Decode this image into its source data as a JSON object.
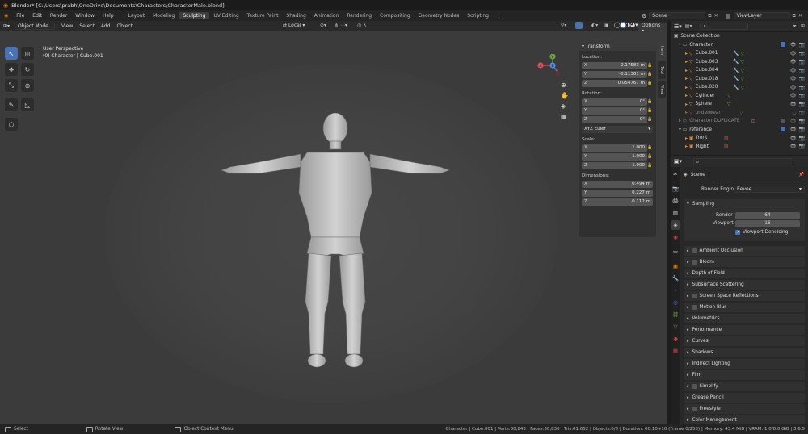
{
  "window": {
    "title": "Blender* [C:\\Users\\prabh\\OneDrive\\Documents\\Characters\\CharacterMale.blend]"
  },
  "menu": {
    "items": [
      "File",
      "Edit",
      "Render",
      "Window",
      "Help"
    ]
  },
  "workspaces": {
    "tabs": [
      "Layout",
      "Modeling",
      "Sculpting",
      "UV Editing",
      "Texture Paint",
      "Shading",
      "Animation",
      "Rendering",
      "Compositing",
      "Geometry Nodes",
      "Scripting"
    ],
    "active": "Sculpting",
    "add": "+"
  },
  "scene": {
    "name": "Scene",
    "view_layer": "ViewLayer"
  },
  "viewport": {
    "mode": "Object Mode",
    "menus": [
      "View",
      "Select",
      "Add",
      "Object"
    ],
    "transform_orientation": "Local",
    "options_label": "Options",
    "perspective": "User Perspective",
    "object_info": "(0) Character | Cube.001",
    "gizmo": {
      "x": "X",
      "y": "Y",
      "z": "Z"
    }
  },
  "npanel": {
    "title": "Transform",
    "location_label": "Location:",
    "location": [
      {
        "axis": "X",
        "value": "0.17583 m"
      },
      {
        "axis": "Y",
        "value": "-0.11361 m"
      },
      {
        "axis": "Z",
        "value": "0.054767 m"
      }
    ],
    "rotation_label": "Rotation:",
    "rotation": [
      {
        "axis": "X",
        "value": "0°"
      },
      {
        "axis": "Y",
        "value": "0°"
      },
      {
        "axis": "Z",
        "value": "0°"
      }
    ],
    "rotation_mode": "XYZ Euler",
    "scale_label": "Scale:",
    "scale": [
      {
        "axis": "X",
        "value": "1.000"
      },
      {
        "axis": "Y",
        "value": "1.000"
      },
      {
        "axis": "Z",
        "value": "1.000"
      }
    ],
    "dimensions_label": "Dimensions:",
    "dimensions": [
      {
        "axis": "X",
        "value": "0.494 m"
      },
      {
        "axis": "Y",
        "value": "0.227 m"
      },
      {
        "axis": "Z",
        "value": "0.112 m"
      }
    ],
    "tabs": [
      "Item",
      "Tool",
      "View"
    ]
  },
  "outliner": {
    "items": [
      {
        "name": "Scene Collection",
        "indent": 0,
        "kind": "scene"
      },
      {
        "name": "Character",
        "indent": 1,
        "kind": "collection"
      },
      {
        "name": "Cube.001",
        "indent": 2,
        "kind": "mesh"
      },
      {
        "name": "Cube.003",
        "indent": 2,
        "kind": "mesh"
      },
      {
        "name": "Cube.004",
        "indent": 2,
        "kind": "mesh"
      },
      {
        "name": "Cube.018",
        "indent": 2,
        "kind": "mesh"
      },
      {
        "name": "Cube.020",
        "indent": 2,
        "kind": "mesh"
      },
      {
        "name": "Cylinder",
        "indent": 2,
        "kind": "mesh"
      },
      {
        "name": "Sphere",
        "indent": 2,
        "kind": "mesh"
      },
      {
        "name": "underwear",
        "indent": 2,
        "kind": "mesh"
      },
      {
        "name": "Character-DUPLICATE",
        "indent": 1,
        "kind": "collection"
      },
      {
        "name": "reference",
        "indent": 1,
        "kind": "collection"
      },
      {
        "name": "front",
        "indent": 2,
        "kind": "image"
      },
      {
        "name": "Right",
        "indent": 2,
        "kind": "image"
      }
    ]
  },
  "properties": {
    "context": "Scene",
    "render_engine_label": "Render Engine",
    "render_engine": "Eevee",
    "sampling": {
      "title": "Sampling",
      "render_label": "Render",
      "render": "64",
      "viewport_label": "Viewport",
      "viewport": "16",
      "denoise": "Viewport Denoising"
    },
    "sections": [
      "Ambient Occlusion",
      "Bloom",
      "Depth of Field",
      "Subsurface Scattering",
      "Screen Space Reflections",
      "Motion Blur",
      "Volumetrics",
      "Performance",
      "Curves",
      "Shadows",
      "Indirect Lighting",
      "Film",
      "Simplify",
      "Grease Pencil",
      "Freestyle",
      "Color Management"
    ],
    "checkbox_sections": [
      "Ambient Occlusion",
      "Bloom",
      "Screen Space Reflections",
      "Motion Blur",
      "Simplify",
      "Freestyle"
    ]
  },
  "statusbar": {
    "left": [
      "Select",
      "Rotate View",
      "Object Context Menu"
    ],
    "right": "Character | Cube.001 | Verts:30,843 | Faces:30,830 | Tris:61,652 | Objects:0/9 | Duration: 00:10+10 (Frame 0/250) | Memory: 43.4 MiB | VRAM: 1.0/8.0 GiB | 3.6.5"
  },
  "colors": {
    "accent": "#4772b3",
    "orange": "#e87d0d",
    "mesh_icon": "#e28c3b",
    "gizmo_x": "#e74b5a",
    "gizmo_y": "#6ba539",
    "gizmo_z": "#4a8ee6"
  }
}
